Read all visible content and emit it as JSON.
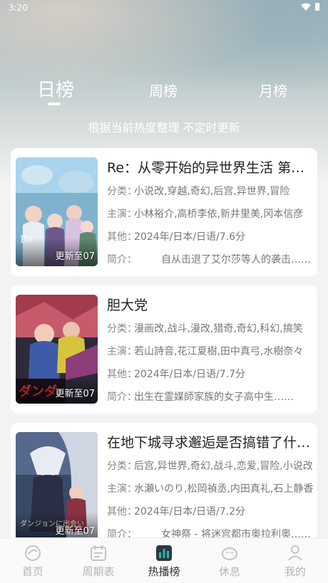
{
  "status_bar": {
    "time": "3:20"
  },
  "tabs": [
    {
      "label": "日榜",
      "active": true
    },
    {
      "label": "周榜",
      "active": false
    },
    {
      "label": "月榜",
      "active": false
    }
  ],
  "subtitle": "根据当前热度整理 不定时更新",
  "items": [
    {
      "title": "Re：从零开始的异世界生活 第三季",
      "badge": "更新至07",
      "category_label": "分类：",
      "category": "小说改,穿越,奇幻,后宫,异世界,冒险",
      "cast_label": "主演：",
      "cast": "小林裕介,高桥李依,新井里美,冈本信彦",
      "other_label": "其他：",
      "other": "2024年/日本/日语/7.6分",
      "intro_label": "简介：",
      "intro": "自从击退了艾尔莎等人的袭击……"
    },
    {
      "title": "胆大党",
      "badge": "更新至07",
      "category_label": "分类：",
      "category": "漫画改,战斗,漫改,猎奇,奇幻,科幻,搞笑",
      "cast_label": "主演：",
      "cast": "若山詩音,花江夏樹,田中真弓,水樹奈々",
      "other_label": "其他：",
      "other": "2024年/日本/日语/7.7分",
      "intro_label": "简介：",
      "intro": "出生在霊媒師家族的女子高中生……"
    },
    {
      "title": "在地下城寻求邂逅是否搞错了什么 第五季",
      "badge": "更新至07",
      "category_label": "分类：",
      "category": "后宫,异世界,奇幻,战斗,恋爱,冒险,小说改",
      "cast_label": "主演：",
      "cast": "水瀬いのり,松岡禎丞,内田真礼,石上静香",
      "other_label": "其他：",
      "other": "2024年/日本/日语/7.2分",
      "intro_label": "简介：",
      "intro": "女神祭 - 将迷宫都市奥拉利奥……"
    }
  ],
  "bottom_nav": [
    {
      "label": "首页",
      "icon": "home-icon",
      "active": false
    },
    {
      "label": "周期表",
      "icon": "calendar-icon",
      "active": false
    },
    {
      "label": "热播榜",
      "icon": "chart-icon",
      "active": true
    },
    {
      "label": "休息",
      "icon": "rest-icon",
      "active": false
    },
    {
      "label": "我的",
      "icon": "profile-icon",
      "active": false
    }
  ],
  "colors": {
    "accent": "#2bb3a8",
    "inactive": "#b5b5b5"
  }
}
